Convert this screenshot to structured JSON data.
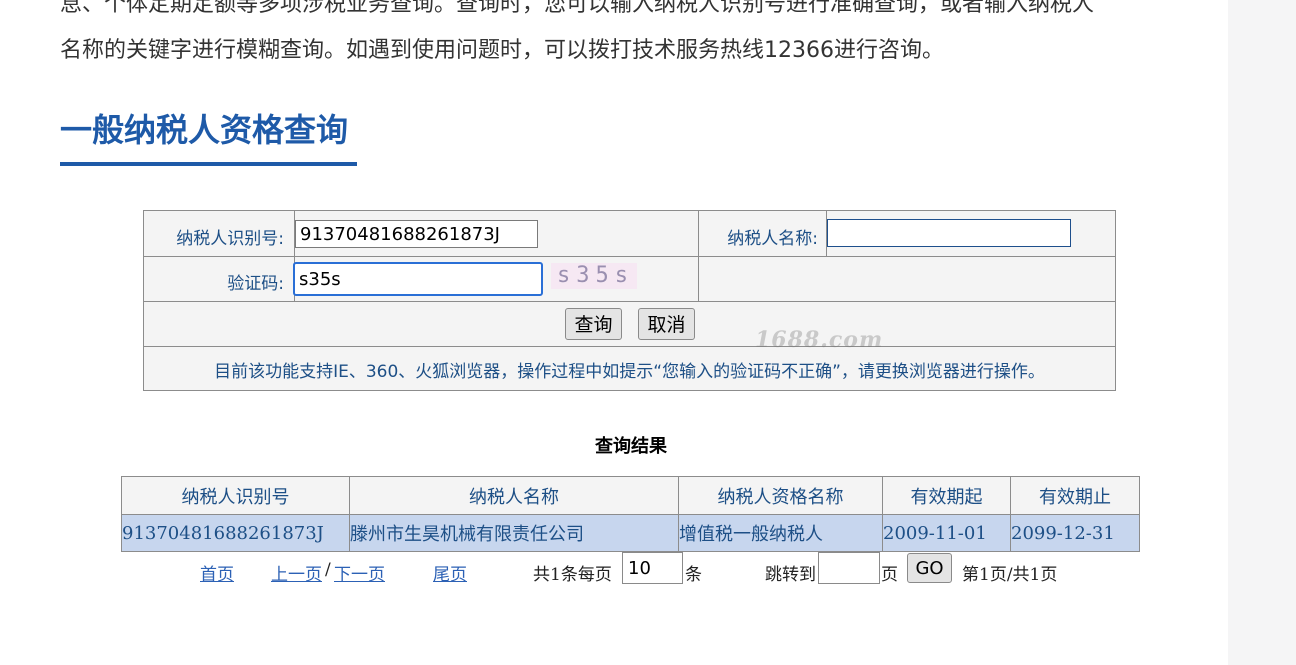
{
  "intro": {
    "line1": "息、个体定期定额等多项涉税业务查询。查询时，您可以输入纳税人识别号进行准确查询，或者输入纳税人",
    "line2": "名称的关键字进行模糊查询。如遇到使用问题时，可以拨打技术服务热线12366进行咨询。"
  },
  "section": {
    "title": "一般纳税人资格查询"
  },
  "form": {
    "taxpayer_id_label": "纳税人识别号:",
    "taxpayer_id_value": "91370481688261873J",
    "taxpayer_name_label": "纳税人名称:",
    "taxpayer_name_value": "",
    "captcha_label": "验证码:",
    "captcha_value": "s35s",
    "captcha_image_text": "s35s",
    "query_button": "查询",
    "cancel_button": "取消",
    "watermark": "1688.com",
    "notice": "目前该功能支持IE、360、火狐浏览器，操作过程中如提示“您输入的验证码不正确”，请更换浏览器进行操作。"
  },
  "results": {
    "title": "查询结果",
    "columns": [
      "纳税人识别号",
      "纳税人名称",
      "纳税人资格名称",
      "有效期起",
      "有效期止"
    ],
    "rows": [
      [
        "91370481688261873J",
        "滕州市生昊机械有限责任公司",
        "增值税一般纳税人",
        "2009-11-01",
        "2099-12-31"
      ]
    ]
  },
  "pager": {
    "first": "首页",
    "prev": "上一页",
    "separator": "/",
    "next": "下一页",
    "last": "尾页",
    "total_text": "共1条每页",
    "page_size": "10",
    "unit": "条",
    "jump_label": "跳转到",
    "jump_value": "",
    "page_unit": "页",
    "go_button": "GO",
    "page_info": "第1页/共1页"
  },
  "colors": {
    "title_blue": "#1e5aa8",
    "label_blue": "#1d4f86",
    "row_highlight": "#c7d6ee",
    "link_blue": "#2c61b5"
  }
}
